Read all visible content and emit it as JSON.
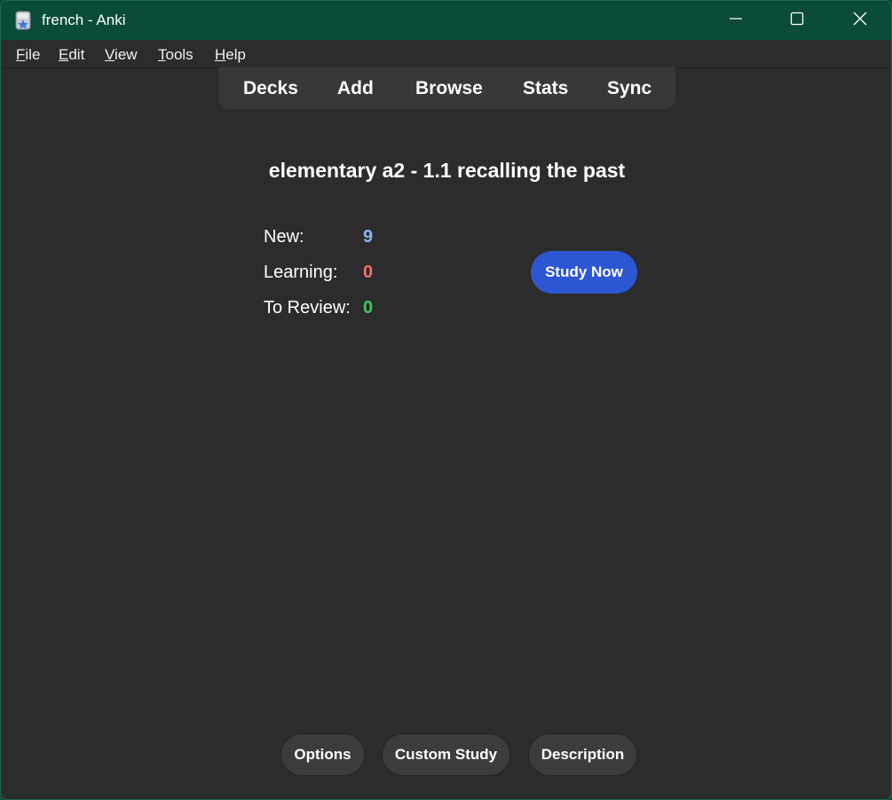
{
  "window": {
    "title": "french - Anki",
    "app_icon": "anki-icon",
    "controls": [
      "minimize-icon",
      "maximize-icon",
      "close-icon"
    ]
  },
  "menubar": {
    "items": [
      {
        "accel": "F",
        "rest": "ile"
      },
      {
        "accel": "E",
        "rest": "dit"
      },
      {
        "accel": "V",
        "rest": "iew"
      },
      {
        "accel": "T",
        "rest": "ools"
      },
      {
        "accel": "H",
        "rest": "elp"
      }
    ]
  },
  "toolbar": {
    "items": [
      "Decks",
      "Add",
      "Browse",
      "Stats",
      "Sync"
    ]
  },
  "overview": {
    "deck_title": "elementary a2 - 1.1 recalling the past",
    "counts": [
      {
        "label": "New:",
        "value": "9",
        "color": "#8fb4f2"
      },
      {
        "label": "Learning:",
        "value": "0",
        "color": "#f2736b"
      },
      {
        "label": "To Review:",
        "value": "0",
        "color": "#3ec766"
      }
    ],
    "study_button": "Study Now",
    "study_button_color": "#2c56d2"
  },
  "bottom_bar": {
    "buttons": [
      "Options",
      "Custom Study",
      "Description"
    ]
  },
  "colors": {
    "titlebar": "#0b4b3a",
    "background": "#2c2c2c",
    "toolbar": "#383838"
  }
}
